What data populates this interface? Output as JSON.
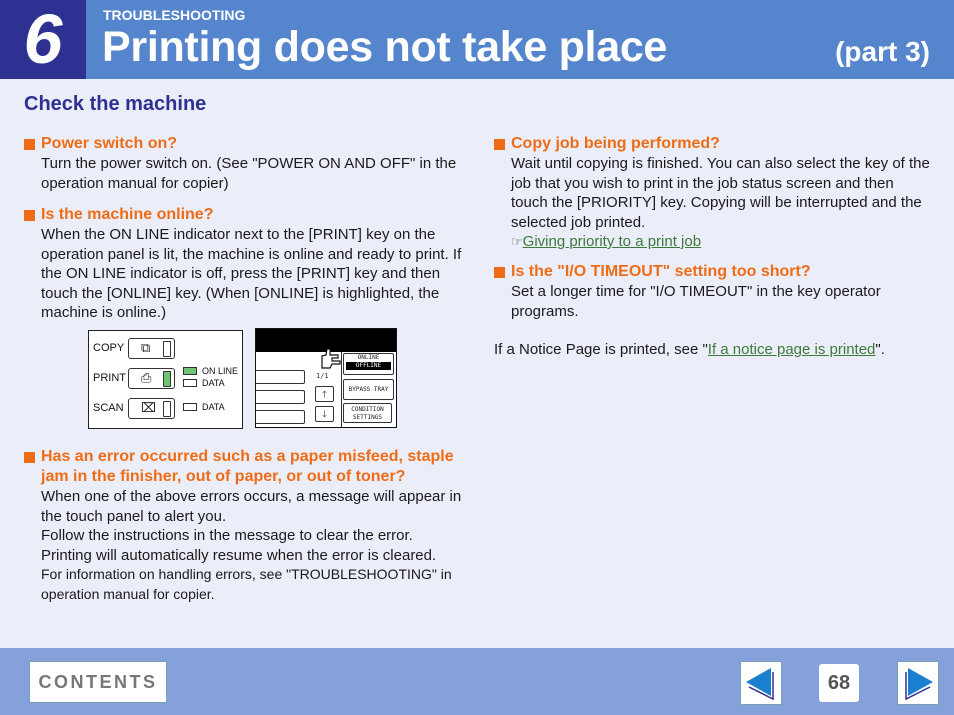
{
  "header": {
    "chapter_number": "6",
    "section_label": "TROUBLESHOOTING",
    "title": "Printing does not take place",
    "part": "(part 3)"
  },
  "subhead": "Check the machine",
  "left_column": {
    "items": [
      {
        "title": "Power switch on?",
        "body": "Turn the power switch on. (See \"POWER ON AND OFF\" in the operation manual for copier)"
      },
      {
        "title": "Is the machine online?",
        "body": "When the ON LINE indicator next to the [PRINT] key on the operation panel is lit, the machine is online and ready to print. If the ON LINE indicator is off, press the [PRINT] key and then touch the [ONLINE] key. (When [ONLINE] is highlighted, the machine is online.)"
      },
      {
        "title": "Has an error occurred such as a paper misfeed, staple jam in the finisher, out of paper, or out of toner?",
        "body_lines": [
          "When one of the above errors occurs, a message will appear in the touch panel to alert you.",
          "Follow the instructions in the message to clear the error.",
          "Printing will automatically resume when the error is cleared."
        ],
        "body_small": "For information on handling errors, see \"TROUBLESHOOTING\" in operation manual for copier."
      }
    ]
  },
  "operation_panel": {
    "keys": [
      {
        "label": "COPY",
        "icon": "copy-icon",
        "lamp_on": false
      },
      {
        "label": "PRINT",
        "icon": "printer-icon",
        "lamp_on": true
      },
      {
        "label": "SCAN",
        "icon": "scanner-icon",
        "lamp_on": false
      }
    ],
    "indicators": [
      {
        "label": "ON LINE",
        "on": true
      },
      {
        "label": "DATA",
        "on": false
      },
      {
        "label": "DATA",
        "on": false
      }
    ]
  },
  "touch_panel": {
    "page_indicator": "1/1",
    "buttons": {
      "online": "ONLINE",
      "offline": "OFFLINE",
      "bypass": "BYPASS TRAY",
      "condition_1": "CONDITION",
      "condition_2": "SETTINGS"
    },
    "up_arrow": "🡑",
    "down_arrow": "🡓"
  },
  "right_column": {
    "items": [
      {
        "title": "Copy job being performed?",
        "body": "Wait until copying is finished. You can also select the key of the job that you wish to print in the job status screen and then touch the [PRIORITY] key. Copying will be interrupted and the selected job printed.",
        "ref_icon": "☞",
        "link": "Giving priority to a print job"
      },
      {
        "title": "Is the \"I/O TIMEOUT\" setting too short?",
        "body": "Set a longer time for \"I/O TIMEOUT\" in the key operator programs."
      }
    ],
    "notice": {
      "prefix": "If a Notice Page is printed, see \"",
      "link": "If a notice page is printed",
      "suffix": "\"."
    }
  },
  "footer": {
    "contents_label": "CONTENTS",
    "page_number": "68",
    "colors": {
      "arrow": "#1a7fcf",
      "arrow_shadow": "#2e3192"
    }
  }
}
